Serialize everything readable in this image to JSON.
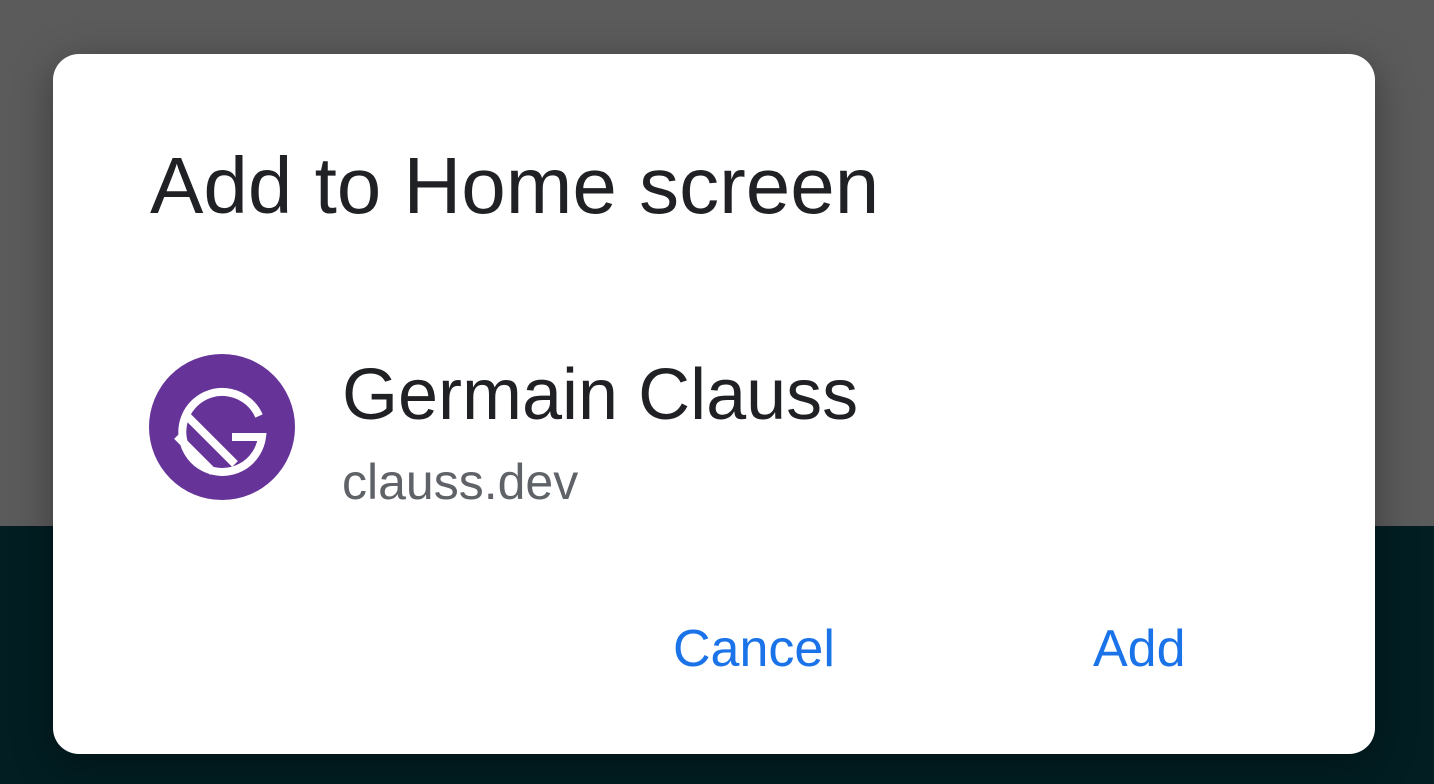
{
  "dialog": {
    "title": "Add to Home screen",
    "app_name": "Germain Clauss",
    "app_url": "clauss.dev",
    "cancel_label": "Cancel",
    "add_label": "Add"
  },
  "icon": {
    "name": "gatsby-logo-icon",
    "color": "#663399"
  },
  "colors": {
    "accent": "#1a73e8",
    "scrim_top": "#5b5b5b",
    "background_bottom": "#021e22"
  }
}
